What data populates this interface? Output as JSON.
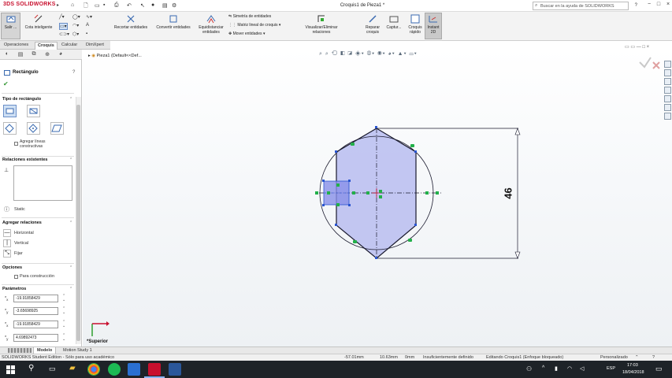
{
  "app": {
    "logo_prefix": "3DS",
    "logo": "SOLIDWORKS",
    "doc_title": "Croquis1 de Pieza1 *",
    "help_search_placeholder": "Buscar en la ayuda de SOLIDWORKS",
    "help_q": "?"
  },
  "commands": {
    "salir": "Salir ...",
    "cota": "Cota inteligente",
    "recortar": "Recortar entidades",
    "convertir": "Convertir entidades",
    "equidistanciar": "Equidistanciar entidades",
    "simetria": "Simetría de entidades",
    "matriz": "Matriz lineal de croquis",
    "mover": "Mover entidades",
    "relaciones": "Visualizar/Eliminar relaciones",
    "reparar": "Reparar croquis",
    "captura": "Captur...",
    "croquis_rapido": "Croquis rápido",
    "instant2d": "Instant 2D"
  },
  "tabs": [
    "Operaciones",
    "Croquis",
    "Calcular",
    "DimXpert"
  ],
  "active_tab": "Croquis",
  "panel": {
    "title": "Rectángulo",
    "help": "?",
    "tipo_header": "Tipo de rectángulo",
    "agregar_lineas": "Agregar líneas constructivas",
    "relaciones_existentes": "Relaciones existentes",
    "static": "Static",
    "agregar_relaciones": "Agregar relaciones",
    "rel_horizontal": "Horizontal",
    "rel_vertical": "Vertical",
    "rel_fijar": "Fijar",
    "opciones": "Opciones",
    "para_construccion": "Para construcción",
    "parametros": "Parámetros",
    "params": [
      {
        "label": "x",
        "value": "-19.91858429"
      },
      {
        "label": "y",
        "value": "-3.65698925"
      },
      {
        "label": "x",
        "value": "-19.91858429"
      },
      {
        "label": "y",
        "value": "4.69892473"
      }
    ]
  },
  "tree": {
    "item": "Pieza1  (Default<<Def..."
  },
  "viewport": {
    "dimension": "46",
    "view_name": "*Superior"
  },
  "bottom_tabs": [
    "Modelo",
    "Motion Study 1"
  ],
  "active_bottom_tab": "Modelo",
  "status": {
    "edition": "SOLIDWORKS Student Edition - Sólo para uso académico",
    "x": "-57.01mm",
    "y": "10.63mm",
    "z": "0mm",
    "state": "Insuficientemente definido",
    "editing": "Editando Croquis1 (Enfoque bloqueado)",
    "units": "Personalizado"
  },
  "taskbar": {
    "lang": "ESP",
    "time": "17:03",
    "date": "18/04/2018"
  },
  "colors": {
    "hex_fill": "#b8bdf0",
    "sketch_line": "#1a1a2e",
    "relation_green": "#22b04a",
    "accent_red": "#c8102e"
  }
}
